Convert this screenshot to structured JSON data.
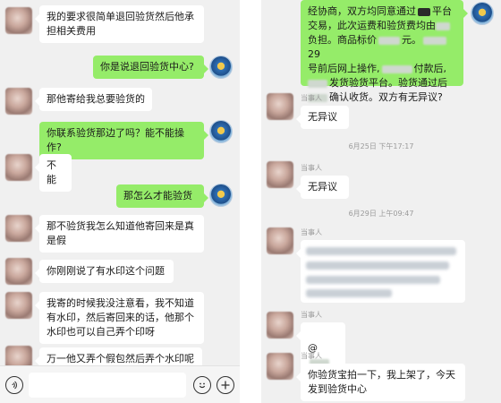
{
  "left_chat": {
    "messages": [
      {
        "side": "in",
        "text": "我的要求很简单退回验货然后他承\n担相关费用"
      },
      {
        "side": "out",
        "text": "你是说退回验货中心?"
      },
      {
        "side": "in",
        "text": "那他寄给我总要验货的"
      },
      {
        "side": "out",
        "text": "你联系验货那边了吗？能不能操作?"
      },
      {
        "side": "in",
        "text": "不能"
      },
      {
        "side": "out",
        "text": "那怎么才能验货"
      },
      {
        "side": "in",
        "text": "那不验货我怎么知道他寄回来是真\n是假"
      },
      {
        "side": "in",
        "text": "你刚刚说了有水印这个问题"
      },
      {
        "side": "in",
        "text": "我寄的时候我没注意看，我不知道\n有水印，然后寄回来的话，他那个\n水印也可以自己弄个印呀"
      },
      {
        "side": "in",
        "text": "万一他又弄个假包然后弄个水印呢"
      }
    ]
  },
  "right_chat": {
    "top_message": {
      "line1": "经协商，双方均同意通过",
      "line1_end": "平台",
      "line2": "交易，此次运费和验货费均由",
      "line3_start": "负担。商品标价",
      "line3_mid": "元。",
      "line3_end": "29",
      "line4_start": "号前后网上操作,",
      "line4_end": "付款后,",
      "line5": "发货验货平台。验货通过后",
      "line6": "确认收货。双方有无异议?"
    },
    "sender_label": "当事人",
    "reply_1": "无异议",
    "timestamp_1": "6月25日 下午17:17",
    "reply_2": "无异议",
    "timestamp_2": "6月29日 上午09:47",
    "reply_3": "@",
    "reply_4": "你验货宝拍一下，我上架了，今天\n发到验货中心"
  },
  "input_bar": {
    "voice_icon": "voice-icon",
    "emoji_icon": "emoji-icon",
    "plus_icon": "plus-icon"
  },
  "colors": {
    "outgoing_bubble": "#95ec69",
    "incoming_bubble": "#ffffff",
    "chat_background": "#f0f0f0"
  }
}
